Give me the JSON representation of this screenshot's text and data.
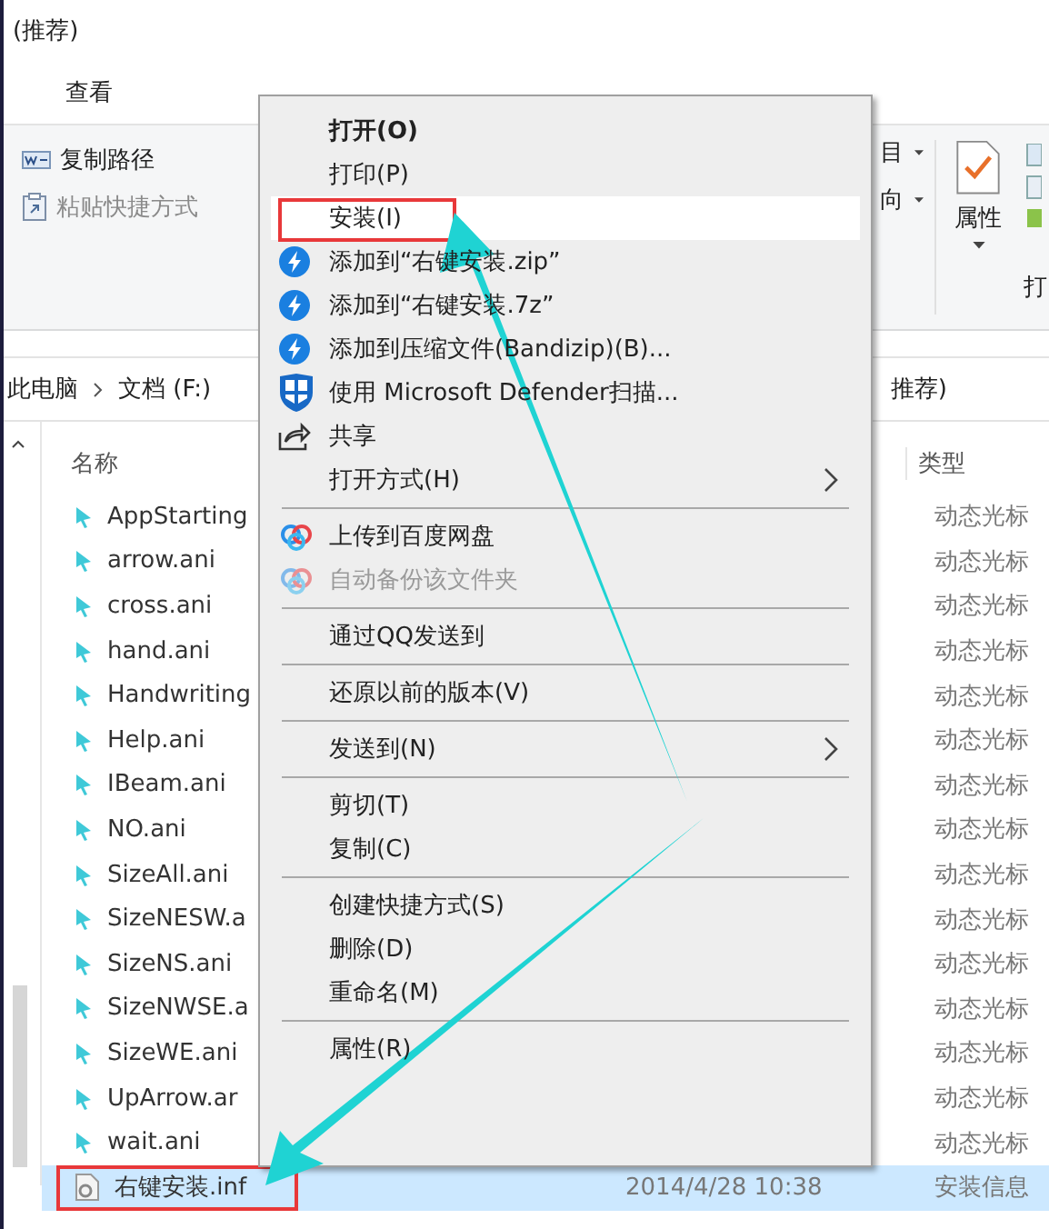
{
  "window": {
    "title": "(推荐)"
  },
  "ribbon": {
    "tab": "查看",
    "commands": [
      {
        "label": "复制路径",
        "disabled": false,
        "kind": "copy-path"
      },
      {
        "label": "粘贴快捷方式",
        "disabled": true,
        "kind": "paste-shortcut"
      }
    ],
    "partial_labels": [
      "目",
      "向"
    ],
    "properties_button": {
      "label": "属性"
    },
    "edge_label": "打"
  },
  "breadcrumb": {
    "items": [
      "此电脑",
      "文档 (F:)"
    ],
    "tail": "推荐)"
  },
  "columns": [
    "名称",
    "类型"
  ],
  "files": [
    {
      "name": "AppStarting",
      "type": "动态光标",
      "kind": "cursor",
      "selected": false,
      "marked": false
    },
    {
      "name": "arrow.ani",
      "type": "动态光标",
      "kind": "cursor",
      "selected": false,
      "marked": false
    },
    {
      "name": "cross.ani",
      "type": "动态光标",
      "kind": "cursor",
      "selected": false,
      "marked": false
    },
    {
      "name": "hand.ani",
      "type": "动态光标",
      "kind": "cursor",
      "selected": false,
      "marked": false
    },
    {
      "name": "Handwriting",
      "type": "动态光标",
      "kind": "cursor",
      "selected": false,
      "marked": false
    },
    {
      "name": "Help.ani",
      "type": "动态光标",
      "kind": "cursor",
      "selected": false,
      "marked": false
    },
    {
      "name": "IBeam.ani",
      "type": "动态光标",
      "kind": "cursor",
      "selected": false,
      "marked": false
    },
    {
      "name": "NO.ani",
      "type": "动态光标",
      "kind": "cursor",
      "selected": false,
      "marked": false
    },
    {
      "name": "SizeAll.ani",
      "type": "动态光标",
      "kind": "cursor",
      "selected": false,
      "marked": false
    },
    {
      "name": "SizeNESW.a",
      "type": "动态光标",
      "kind": "cursor",
      "selected": false,
      "marked": false
    },
    {
      "name": "SizeNS.ani",
      "type": "动态光标",
      "kind": "cursor",
      "selected": false,
      "marked": false
    },
    {
      "name": "SizeNWSE.a",
      "type": "动态光标",
      "kind": "cursor",
      "selected": false,
      "marked": false
    },
    {
      "name": "SizeWE.ani",
      "type": "动态光标",
      "kind": "cursor",
      "selected": false,
      "marked": false
    },
    {
      "name": "UpArrow.ar",
      "type": "动态光标",
      "kind": "cursor",
      "selected": false,
      "marked": false
    },
    {
      "name": "wait.ani",
      "type": "动态光标",
      "kind": "cursor",
      "selected": false,
      "marked": false
    },
    {
      "name": "右键安装.inf",
      "date": "2014/4/28 10:38",
      "type": "安装信息",
      "kind": "setup",
      "selected": true,
      "marked": true
    }
  ],
  "context_menu": {
    "items": [
      {
        "kind": "item",
        "label": "打开(O)",
        "bold": true,
        "selected": false,
        "disabled": false,
        "submenu": false,
        "marked": false
      },
      {
        "kind": "item",
        "label": "打印(P)",
        "bold": false,
        "selected": false,
        "disabled": false,
        "submenu": false,
        "marked": false
      },
      {
        "kind": "item",
        "label": "安装(I)",
        "bold": false,
        "selected": true,
        "disabled": false,
        "submenu": false,
        "marked": true
      },
      {
        "kind": "zip",
        "label": "添加到“右键安装.zip”",
        "bold": false,
        "selected": false,
        "disabled": false,
        "submenu": false,
        "marked": false
      },
      {
        "kind": "zip",
        "label": "添加到“右键安装.7z”",
        "bold": false,
        "selected": false,
        "disabled": false,
        "submenu": false,
        "marked": false
      },
      {
        "kind": "zip",
        "label": "添加到压缩文件(Bandizip)(B)...",
        "bold": false,
        "selected": false,
        "disabled": false,
        "submenu": false,
        "marked": false
      },
      {
        "kind": "scan",
        "label": "使用 Microsoft Defender扫描...",
        "bold": false,
        "selected": false,
        "disabled": false,
        "submenu": false,
        "marked": false
      },
      {
        "kind": "share",
        "label": "共享",
        "bold": false,
        "selected": false,
        "disabled": false,
        "submenu": false,
        "marked": false
      },
      {
        "kind": "item",
        "label": "打开方式(H)",
        "bold": false,
        "selected": false,
        "disabled": false,
        "submenu": true,
        "marked": false
      },
      {
        "kind": "separator"
      },
      {
        "kind": "cloud",
        "label": "上传到百度网盘",
        "bold": false,
        "selected": false,
        "disabled": false,
        "submenu": false,
        "marked": false
      },
      {
        "kind": "cloud",
        "label": "自动备份该文件夹",
        "bold": false,
        "selected": false,
        "disabled": true,
        "submenu": false,
        "marked": false
      },
      {
        "kind": "separator"
      },
      {
        "kind": "item",
        "label": "通过QQ发送到",
        "bold": false,
        "selected": false,
        "disabled": false,
        "submenu": false,
        "marked": false
      },
      {
        "kind": "separator"
      },
      {
        "kind": "item",
        "label": "还原以前的版本(V)",
        "bold": false,
        "selected": false,
        "disabled": false,
        "submenu": false,
        "marked": false
      },
      {
        "kind": "separator"
      },
      {
        "kind": "item",
        "label": "发送到(N)",
        "bold": false,
        "selected": false,
        "disabled": false,
        "submenu": true,
        "marked": false
      },
      {
        "kind": "separator"
      },
      {
        "kind": "item",
        "label": "剪切(T)",
        "bold": false,
        "selected": false,
        "disabled": false,
        "submenu": false,
        "marked": false
      },
      {
        "kind": "item",
        "label": "复制(C)",
        "bold": false,
        "selected": false,
        "disabled": false,
        "submenu": false,
        "marked": false
      },
      {
        "kind": "separator"
      },
      {
        "kind": "item",
        "label": "创建快捷方式(S)",
        "bold": false,
        "selected": false,
        "disabled": false,
        "submenu": false,
        "marked": false
      },
      {
        "kind": "item",
        "label": "删除(D)",
        "bold": false,
        "selected": false,
        "disabled": false,
        "submenu": false,
        "marked": false
      },
      {
        "kind": "item",
        "label": "重命名(M)",
        "bold": false,
        "selected": false,
        "disabled": false,
        "submenu": false,
        "marked": false
      },
      {
        "kind": "separator"
      },
      {
        "kind": "item",
        "label": "属性(R)",
        "bold": false,
        "selected": false,
        "disabled": false,
        "submenu": false,
        "marked": false
      }
    ]
  }
}
